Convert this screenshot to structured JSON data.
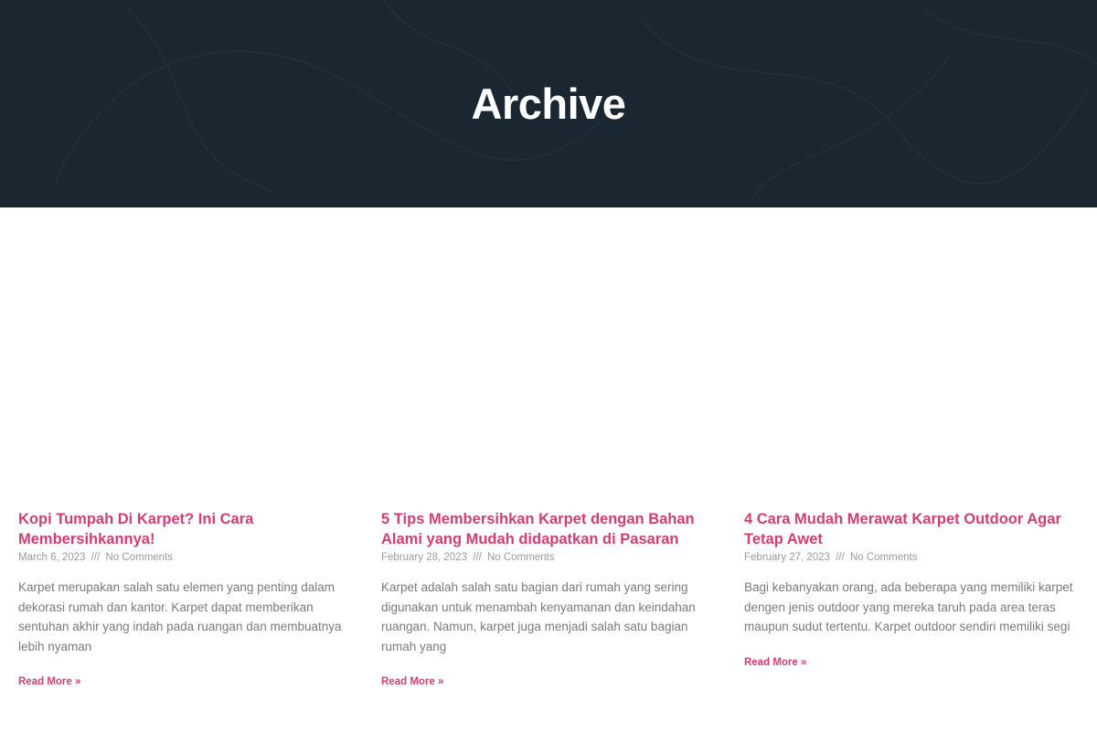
{
  "hero": {
    "title": "Archive"
  },
  "posts": [
    {
      "title": "Kopi Tumpah Di Karpet? Ini Cara Membersihkannya!",
      "date": "March 6, 2023",
      "separator": "///",
      "comments": "No Comments",
      "excerpt": "Karpet merupakan salah satu elemen yang penting dalam dekorasi rumah dan kantor. Karpet dapat memberikan sentuhan akhir yang indah pada ruangan dan membuatnya lebih nyaman",
      "read_more": "Read More »"
    },
    {
      "title": "5 Tips Membersihkan Karpet dengan Bahan Alami yang Mudah didapatkan di Pasaran",
      "date": "February 28, 2023",
      "separator": "///",
      "comments": "No Comments",
      "excerpt": "Karpet adalah salah satu bagian dari rumah yang sering digunakan untuk menambah kenyamanan dan keindahan ruangan. Namun, karpet juga menjadi salah satu bagian rumah yang",
      "read_more": "Read More »"
    },
    {
      "title": "4 Cara Mudah Merawat Karpet Outdoor Agar Tetap Awet",
      "date": "February 27, 2023",
      "separator": "///",
      "comments": "No Comments",
      "excerpt": "Bagi kebanyakan orang, ada beberapa yang memiliki karpet dengen jenis outdoor yang mereka taruh pada area teras maupun sudut tertentu. Karpet outdoor sendiri memiliki segi",
      "read_more": "Read More »"
    }
  ],
  "colors": {
    "hero_bg": "#1a2630",
    "accent": "#d63c74",
    "meta": "#9a9a9a",
    "body_text": "#7a7a7a"
  }
}
